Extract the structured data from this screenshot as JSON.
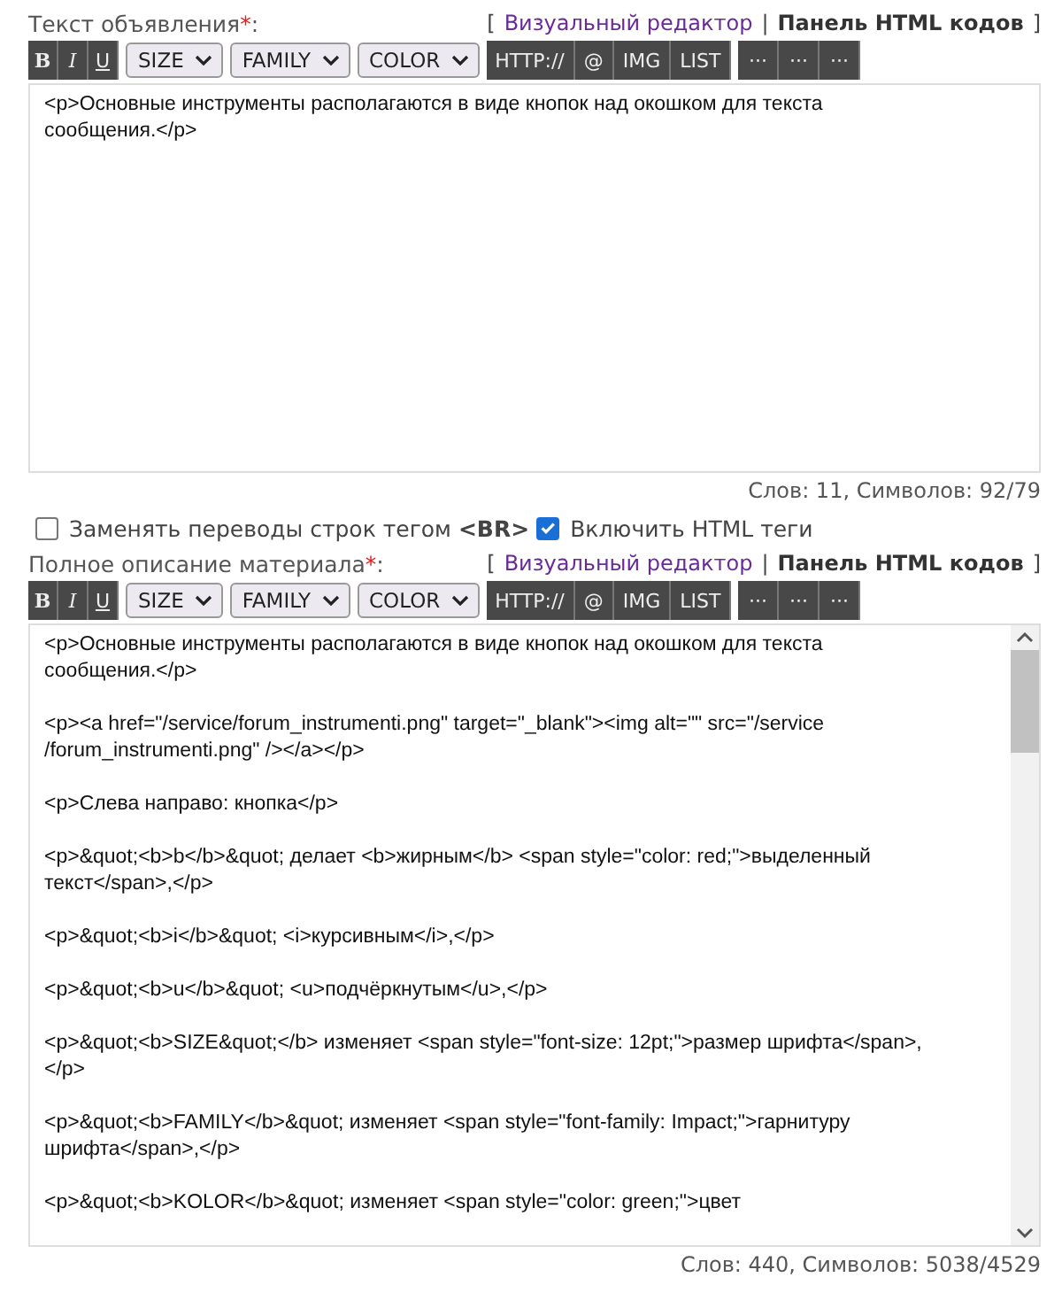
{
  "editors": [
    {
      "label": "Текст объявления",
      "required_mark": "*",
      "label_suffix": ":",
      "bracket_open": "[",
      "separator": "|",
      "bracket_close": "]",
      "modes": [
        {
          "label": "Визуальный редактор",
          "selected": false
        },
        {
          "label": "Панель HTML кодов",
          "selected": true
        }
      ],
      "toolbar": [
        {
          "kind": "bold",
          "label": "B"
        },
        {
          "kind": "italic",
          "label": "I"
        },
        {
          "kind": "underline",
          "label": "U"
        },
        {
          "kind": "select",
          "label": "SIZE"
        },
        {
          "kind": "select",
          "label": "FAMILY"
        },
        {
          "kind": "select",
          "label": "COLOR"
        },
        {
          "kind": "button",
          "label": "HTTP://"
        },
        {
          "kind": "button",
          "label": "@"
        },
        {
          "kind": "button",
          "label": "IMG"
        },
        {
          "kind": "button",
          "label": "LIST"
        },
        {
          "kind": "more",
          "label": "···"
        },
        {
          "kind": "more",
          "label": "···"
        },
        {
          "kind": "more",
          "label": "···"
        }
      ],
      "scrollable": false,
      "paragraphs": [
        "<p>Основные инструменты располагаются в виде кнопок над окошком для текста сообщения.</p>"
      ],
      "counter": "Слов: 11, Символов: 92/79"
    },
    {
      "label": "Полное описание материала",
      "required_mark": "*",
      "label_suffix": ":",
      "bracket_open": "[",
      "separator": "|",
      "bracket_close": "]",
      "modes": [
        {
          "label": "Визуальный редактор",
          "selected": false
        },
        {
          "label": "Панель HTML кодов",
          "selected": true
        }
      ],
      "toolbar": [
        {
          "kind": "bold",
          "label": "B"
        },
        {
          "kind": "italic",
          "label": "I"
        },
        {
          "kind": "underline",
          "label": "U"
        },
        {
          "kind": "select",
          "label": "SIZE"
        },
        {
          "kind": "select",
          "label": "FAMILY"
        },
        {
          "kind": "select",
          "label": "COLOR"
        },
        {
          "kind": "button",
          "label": "HTTP://"
        },
        {
          "kind": "button",
          "label": "@"
        },
        {
          "kind": "button",
          "label": "IMG"
        },
        {
          "kind": "button",
          "label": "LIST"
        },
        {
          "kind": "more",
          "label": "···"
        },
        {
          "kind": "more",
          "label": "···"
        },
        {
          "kind": "more",
          "label": "···"
        }
      ],
      "scrollable": true,
      "paragraphs": [
        "<p>Основные инструменты располагаются в виде кнопок над окошком для текста сообщения.</p>",
        "<p><a href=\"/service/forum_instrumenti.png\" target=\"_blank\"><img alt=\"\" src=\"/service /forum_instrumenti.png\" /></a></p>",
        "<p>Слева направо: кнопка</p>",
        "<p>&quot;<b>b</b>&quot; делает <b>жирным</b> <span style=\"color: red;\">выделенный текст</span>,</p>",
        "<p>&quot;<b>i</b>&quot; <i>курсивным</i>,</p>",
        "<p>&quot;<b>u</b>&quot; <u>подчёркнутым</u>,</p>",
        "<p>&quot;<b>SIZE&quot;</b> изменяет <span style=\"font-size: 12pt;\">размер шрифта</span>,</p>",
        "<p>&quot;<b>FAMILY</b>&quot; изменяет <span style=\"font-family: Impact;\">гарнитуру шрифта</span>,</p>",
        "<p>&quot;<b>KOLOR</b>&quot; изменяет <span style=\"color: green;\">цвет"
      ],
      "counter": "Слов: 440, Символов: 5038/4529"
    }
  ],
  "options": [
    {
      "label": "Заменять переводы строк тегом **<BR>**",
      "checked": false
    },
    {
      "label": "Включить HTML теги",
      "checked": true
    }
  ]
}
